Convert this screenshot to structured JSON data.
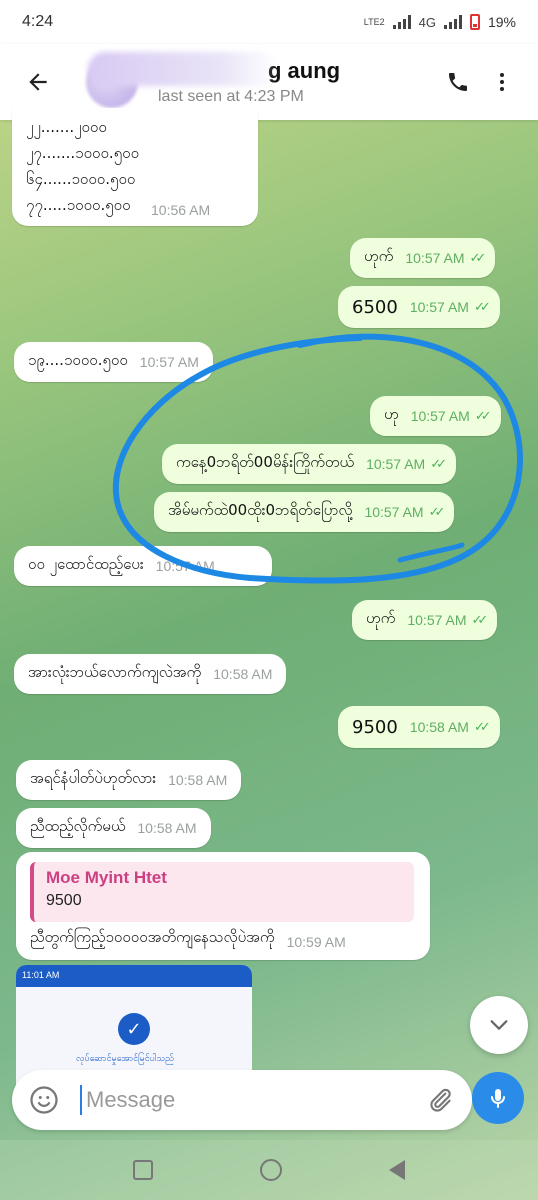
{
  "status_bar": {
    "time": "4:24",
    "network": "LTE2",
    "network_type": "4G",
    "battery": "19%"
  },
  "header": {
    "chat_name": "g aung",
    "last_seen": "last seen at 4:23 PM"
  },
  "messages": [
    {
      "id": "m1",
      "dir": "in",
      "lines": [
        "၂၂.......၂၀၀၀",
        "၂၇.......၁၀၀၀.၅၀၀",
        "၆၄......၁၀၀၀.၅၀၀",
        "၇၇.....၁၀၀၀.၅၀၀"
      ],
      "time": "10:56 AM"
    },
    {
      "id": "m2",
      "dir": "out",
      "text": "ဟုက်",
      "time": "10:57 AM"
    },
    {
      "id": "m3",
      "dir": "out",
      "text": "6500",
      "time": "10:57 AM"
    },
    {
      "id": "m4",
      "dir": "in",
      "text": "၁၉....၁၀၀၀.၅၀၀",
      "time": "10:57 AM"
    },
    {
      "id": "m5",
      "dir": "out",
      "text": "ဟု",
      "time": "10:57 AM"
    },
    {
      "id": "m6",
      "dir": "out",
      "text": "ကနေ့0ဘရိတ်00မိန်းကြိုက်တယ်",
      "time": "10:57 AM"
    },
    {
      "id": "m7",
      "dir": "out",
      "text": "အိမ်မက်ထဲ00ထိုး0ဘရိတ်ပြောလို့",
      "time": "10:57 AM"
    },
    {
      "id": "m8",
      "dir": "in",
      "text": "၀၀ ၂ထောင်ထည့်ပေး",
      "time": "10:57 AM"
    },
    {
      "id": "m9",
      "dir": "out",
      "text": "ဟုက်",
      "time": "10:57 AM"
    },
    {
      "id": "m10",
      "dir": "in",
      "text": "အားလုံးဘယ်လောက်ကျလဲအကို",
      "time": "10:58 AM"
    },
    {
      "id": "m11",
      "dir": "out",
      "text": "9500",
      "time": "10:58 AM"
    },
    {
      "id": "m12",
      "dir": "in",
      "text": "အရင်နံပါတ်ပဲဟုတ်လား",
      "time": "10:58 AM"
    },
    {
      "id": "m13",
      "dir": "in",
      "text": "ညီထည့်လိုက်မယ်",
      "time": "10:58 AM"
    },
    {
      "id": "m14",
      "dir": "in",
      "quote_name": "Moe Myint Htet",
      "quote_text": "9500",
      "text": "ညီတွက်ကြည့်၁၀၀၀၀အတိကျနေသလိုပဲအကို",
      "time": "10:59 AM"
    }
  ],
  "receipt": {
    "top_time": "11:01 AM",
    "line": "လုပ်ဆောင်မှုအောင်မြင်ပါသည်"
  },
  "composer": {
    "placeholder": "Message"
  },
  "colors": {
    "outgoing_bubble": "#effedd",
    "incoming_bubble": "#ffffff",
    "ticks": "#4bb35a",
    "accent": "#2a8ce8",
    "annotation": "#1e88e5",
    "quote": "#cc3f81"
  }
}
